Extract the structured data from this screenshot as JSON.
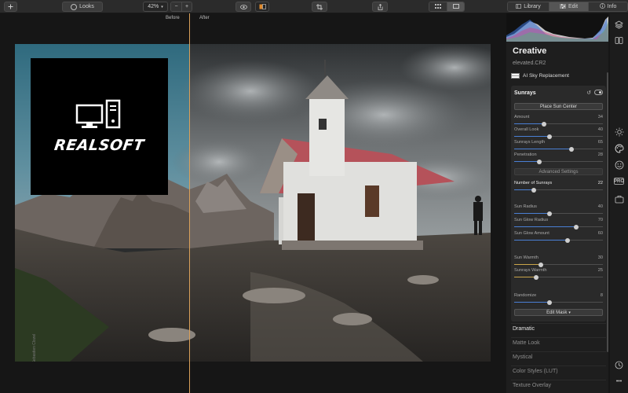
{
  "toolbar": {
    "add_icon": "plus-icon",
    "looks_label": "Looks",
    "zoom_value": "42%",
    "zoom_out_label": "−",
    "zoom_in_label": "+",
    "compare_icon": "eye-icon",
    "split_view_icon": "split-view-icon",
    "crop_icon": "crop-icon",
    "share_icon": "share-icon",
    "grid_view_icon": "grid-view-icon",
    "single_view_icon": "single-view-icon",
    "tabs": [
      {
        "label": "Library",
        "icon": "library-icon"
      },
      {
        "label": "Edit",
        "icon": "sliders-icon"
      },
      {
        "label": "Info",
        "icon": "info-icon"
      }
    ],
    "active_tab": "Edit"
  },
  "compare": {
    "before_label": "Before",
    "after_label": "After",
    "divider_color": "#d9a05a"
  },
  "overlay_logo": {
    "text": "REALSOFT"
  },
  "panel": {
    "title": "Creative",
    "filename": "elevated.CR2",
    "filter_above": "AI Sky Replacement",
    "card": {
      "title": "Sunrays",
      "place_sun_button": "Place Sun Center",
      "advanced_button": "Advanced Settings",
      "edit_mask_button": "Edit Mask",
      "edit_mask_caret": "▾",
      "sliders_basic": [
        {
          "label": "Amount",
          "value": 34
        },
        {
          "label": "Overall Look",
          "value": 40
        },
        {
          "label": "Sunrays Length",
          "value": 65
        },
        {
          "label": "Penetration",
          "value": 28
        }
      ],
      "number_of_sunrays": {
        "label": "Number of Sunrays",
        "value": 22,
        "max": 100
      },
      "sliders_glow": [
        {
          "label": "Sun Radius",
          "value": 40
        },
        {
          "label": "Sun Glow Radius",
          "value": 70
        },
        {
          "label": "Sun Glow Amount",
          "value": 60
        }
      ],
      "sliders_warmth": [
        {
          "label": "Sun Warmth",
          "value": 30
        },
        {
          "label": "Sunrays Warmth",
          "value": 25
        }
      ],
      "randomize": {
        "label": "Randomize",
        "value": 8,
        "max": 20
      },
      "accent_color": "#4a7fd4",
      "warmth_color": "#c9a44a"
    },
    "filters_below": [
      {
        "label": "Dramatic",
        "active": true
      },
      {
        "label": "Matte Look",
        "active": false
      },
      {
        "label": "Mystical",
        "active": false
      },
      {
        "label": "Color Styles (LUT)",
        "active": false
      },
      {
        "label": "Texture Overlay",
        "active": false
      }
    ]
  },
  "side_icons": [
    "layers-icon",
    "compare-panels-icon",
    "sun-icon",
    "palette-icon",
    "smiley-icon",
    "pro-icon",
    "briefcase-icon",
    "clock-icon",
    "more-icon"
  ],
  "side_pro_label": "PRO",
  "side_more_label": "•••"
}
